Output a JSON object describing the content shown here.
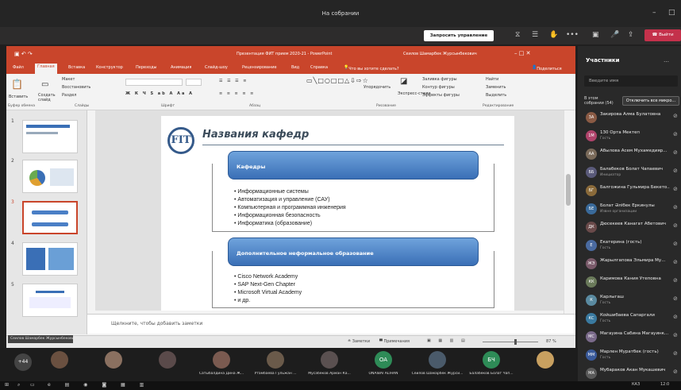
{
  "teams": {
    "window_title": "На собрании",
    "request_control": "Запросить управление",
    "leave": "Выйти",
    "dots": "•••"
  },
  "ppt": {
    "title": "Презентация ФИТ прием 2020-21 - PowerPoint",
    "user": "Сеилов Шамарбек Журсынбекович",
    "tell_me": "Что вы хотите сделать?",
    "share": "Поделиться",
    "tabs": [
      "Файл",
      "Главная",
      "Вставка",
      "Конструктор",
      "Переходы",
      "Анимация",
      "Слайд-шоу",
      "Рецензирование",
      "Вид",
      "Справка"
    ],
    "ribbon": {
      "paste": "Вставить",
      "create_slide": "Создать слайд",
      "layout": "Макет",
      "restore": "Восстановить",
      "section": "Раздел",
      "group_clipboard": "Буфер обмена",
      "group_slides": "Слайды",
      "group_font": "Шрифт",
      "group_paragraph": "Абзац",
      "group_drawing": "Рисование",
      "group_editing": "Редактирование",
      "arrange": "Упорядочить",
      "quick_styles": "Экспресс-стили",
      "shape_fill": "Заливка фигуры",
      "shape_outline": "Контур фигуры",
      "shape_effects": "Эффекты фигуры",
      "find": "Найти",
      "replace": "Заменить",
      "select": "Выделить"
    },
    "thumb_numbers": [
      "1",
      "2",
      "3",
      "4",
      "5"
    ],
    "notes_placeholder": "Щелкните, чтобы добавить заметки",
    "status": {
      "notes": "Заметки",
      "comments": "Примечания",
      "zoom": "87 %"
    },
    "presenter_tag": "Сеилов Шамарбек Журсынбекович"
  },
  "slide": {
    "logo_text": "FIT",
    "title": "Названия кафедр",
    "box1_title": "Кафедры",
    "box1_items": [
      "• Информационные системы",
      "• Автоматизация и управление (САУ)",
      "• Компьютерная и программная инженерия",
      "• Информационная безопасность",
      "• Информатика (образование)"
    ],
    "box2_title": "Дополнительное неформальное образование",
    "box2_items": [
      "• Cisco Network Academy",
      "• SAP Next-Gen Chapter",
      "• Microsoft Virtual Academy",
      "• и др."
    ]
  },
  "participants": {
    "header": "Участники",
    "search_placeholder": "Введите имя",
    "in_meeting": "В этом собрании (54)",
    "mute_all": "Отключить все микро...",
    "list": [
      {
        "name": "Закирова Алма Булатовна",
        "role": "",
        "initials": "ЗА",
        "color": "#8a5a44"
      },
      {
        "name": "130 Орта Мектеп",
        "role": "Гость",
        "initials": "1М",
        "color": "#b0436b"
      },
      {
        "name": "Абылова Асем Мухамедияр...",
        "role": "",
        "initials": "АА",
        "color": "#7a6a5a"
      },
      {
        "name": "Балабеков Болат Чапаевич",
        "role": "Инициатор",
        "initials": "ББ",
        "color": "#5a5a7a"
      },
      {
        "name": "Балгожина Гульмира Бекето...",
        "role": "",
        "initials": "БГ",
        "color": "#8a6a3a"
      },
      {
        "name": "Болат Әлібек Еркинулы",
        "role": "Извне организации",
        "initials": "БЕ",
        "color": "#3a6a9a"
      },
      {
        "name": "Дюсекеев Канагат Абетович",
        "role": "",
        "initials": "ДК",
        "color": "#6a4a4a"
      },
      {
        "name": "Екатерина (гость)",
        "role": "Гость",
        "initials": "Е",
        "color": "#4a6aa0"
      },
      {
        "name": "Жарылгапова Эльмира Му...",
        "role": "",
        "initials": "ЖЭ",
        "color": "#7a5a6a"
      },
      {
        "name": "Каримова Кания Утеповна",
        "role": "",
        "initials": "КК",
        "color": "#6a7a5a"
      },
      {
        "name": "Карлыгаш",
        "role": "Гость",
        "initials": "К",
        "color": "#5a8aa0"
      },
      {
        "name": "Койшибаева Сапаргали",
        "role": "Гость",
        "initials": "КС",
        "color": "#3a7aa0"
      },
      {
        "name": "Магауина Сабина Магауинк...",
        "role": "",
        "initials": "МС",
        "color": "#7a6a8a"
      },
      {
        "name": "Марлен Муратбек (гость)",
        "role": "Гость",
        "initials": "ММ",
        "color": "#3a5a9a"
      },
      {
        "name": "Мубараков Акан Мукашевич",
        "role": "",
        "initials": "МА",
        "color": "#5a5a5a"
      }
    ]
  },
  "strip": {
    "count": "+44",
    "tiles": [
      {
        "name": "",
        "initials": "",
        "color": "#6a5040"
      },
      {
        "name": "",
        "initials": "",
        "color": "#8a7060"
      },
      {
        "name": "",
        "initials": "",
        "color": "#5a4a4a"
      },
      {
        "name": "Сатыбалдина Дина Ж...",
        "initials": "",
        "color": "#7a5a50"
      },
      {
        "name": "Утамбаева Гульжан ...",
        "initials": "",
        "color": "#6a5a4a"
      },
      {
        "name": "Мусабеков Арман Ка...",
        "initials": "",
        "color": "#5a5050"
      },
      {
        "name": "ONAIBAI ALIHAN",
        "initials": "OA",
        "color": "#2e8b57"
      },
      {
        "name": "Сеилов Шамарбек Журси...",
        "initials": "",
        "color": "#4a5a6a"
      },
      {
        "name": "Балабеков Болат Чап...",
        "initials": "БЧ",
        "color": "#2e8b57"
      },
      {
        "name": "",
        "initials": "",
        "color": "#c8a060"
      }
    ]
  },
  "taskbar": {
    "lang": "КАЗ",
    "time": "12:0"
  }
}
